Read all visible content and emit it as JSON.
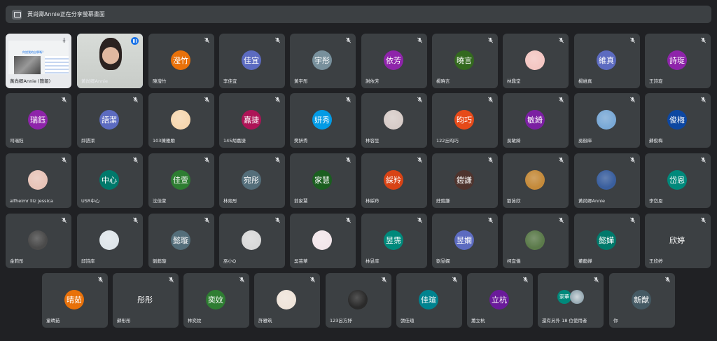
{
  "banner": {
    "text": "黃尚卿Annie正在分享螢幕畫面",
    "icon": "screen-share-icon"
  },
  "share_tile": {
    "slide_title": "你說我的自學嗎？",
    "name": "黃尚卿Annie (簡報)"
  },
  "self_tile": {
    "name": "黃尚卿Annie"
  },
  "tiles": [
    {
      "id": "t1",
      "name": "陳瀅竹",
      "initials": "瀅竹",
      "color": "#e8710a",
      "kind": "initials"
    },
    {
      "id": "t2",
      "name": "李佳宜",
      "initials": "佳宜",
      "color": "#5c6bc0",
      "kind": "initials"
    },
    {
      "id": "t3",
      "name": "黃宇彤",
      "initials": "宇彤",
      "color": "#78909c",
      "kind": "initials"
    },
    {
      "id": "t4",
      "name": "謝依芳",
      "initials": "依芳",
      "color": "#8e24aa",
      "kind": "initials"
    },
    {
      "id": "t5",
      "name": "楊曉言",
      "initials": "曉言",
      "color": "#33691e",
      "kind": "initials"
    },
    {
      "id": "t6",
      "name": "林鼎堂",
      "color": "#f4c7c3",
      "kind": "photo"
    },
    {
      "id": "t7",
      "name": "楊維真",
      "initials": "維真",
      "color": "#5c6bc0",
      "kind": "initials"
    },
    {
      "id": "t8",
      "name": "王詩琁",
      "initials": "詩琁",
      "color": "#8e24aa",
      "kind": "initials"
    },
    {
      "id": "t9",
      "name": "司瑞鈺",
      "initials": "瑞鈺",
      "color": "#8e24aa",
      "kind": "initials"
    },
    {
      "id": "t10",
      "name": "邱語潔",
      "initials": "語潔",
      "color": "#5c6bc0",
      "kind": "initials"
    },
    {
      "id": "t11",
      "name": "103陳雅勛",
      "color": "#f6d7b0",
      "kind": "photo"
    },
    {
      "id": "t12",
      "name": "145胡嘉捷",
      "initials": "嘉捷",
      "color": "#ad1457",
      "kind": "initials"
    },
    {
      "id": "t13",
      "name": "樊妍秀",
      "initials": "妍秀",
      "color": "#039be5",
      "kind": "initials"
    },
    {
      "id": "t14",
      "name": "林容呈",
      "color": "#d7ccc8",
      "kind": "photo"
    },
    {
      "id": "t15",
      "name": "122丘昀巧",
      "initials": "昀巧",
      "color": "#e64a19",
      "kind": "initials"
    },
    {
      "id": "t16",
      "name": "吳敏綺",
      "initials": "敏綺",
      "color": "#7b1fa2",
      "kind": "initials"
    },
    {
      "id": "t17",
      "name": "吳御庠",
      "color": "#7aa9d6",
      "kind": "photo"
    },
    {
      "id": "t18",
      "name": "蘇俊梅",
      "initials": "俊梅",
      "color": "#0d47a1",
      "kind": "initials"
    },
    {
      "id": "t19",
      "name": "alfheimr liiz jessica",
      "color": "#e8c4b8",
      "kind": "photo"
    },
    {
      "id": "t20",
      "name": "USR中心",
      "initials": "中心",
      "color": "#00796b",
      "kind": "initials"
    },
    {
      "id": "t21",
      "name": "沈佳萱",
      "initials": "佳萱",
      "color": "#2e7d32",
      "kind": "initials"
    },
    {
      "id": "t22",
      "name": "林宛彤",
      "initials": "宛彤",
      "color": "#546e7a",
      "kind": "initials"
    },
    {
      "id": "t23",
      "name": "翁家慧",
      "initials": "家慧",
      "color": "#1b5e20",
      "kind": "initials"
    },
    {
      "id": "t24",
      "name": "林綵羚",
      "initials": "綵羚",
      "color": "#d84315",
      "kind": "initials"
    },
    {
      "id": "t25",
      "name": "莊鎧謙",
      "initials": "鎧謙",
      "color": "#4e342e",
      "kind": "initials"
    },
    {
      "id": "t26",
      "name": "劉詠欣",
      "color": "#c48a3a",
      "kind": "photo"
    },
    {
      "id": "t27",
      "name": "黃尚卿Annie",
      "color": "#3a5f9e",
      "kind": "photo"
    },
    {
      "id": "t28",
      "name": "李岱恩",
      "initials": "岱恩",
      "color": "#00897b",
      "kind": "initials"
    },
    {
      "id": "t29",
      "name": "金莉彤",
      "color": "#4a4a4a",
      "kind": "photo"
    },
    {
      "id": "t30",
      "name": "邱詩庠",
      "color": "#dfe6ea",
      "kind": "photo"
    },
    {
      "id": "t31",
      "name": "劉懿璇",
      "initials": "懿璇",
      "color": "#546e7a",
      "kind": "initials"
    },
    {
      "id": "t32",
      "name": "巫小Q",
      "color": "#d9d9d9",
      "kind": "photo"
    },
    {
      "id": "t33",
      "name": "吳芸華",
      "color": "#f2e6ea",
      "kind": "photo"
    },
    {
      "id": "t34",
      "name": "林昱庠",
      "initials": "昱霈",
      "color": "#00897b",
      "kind": "initials"
    },
    {
      "id": "t35",
      "name": "劉昱嫻",
      "initials": "昱嫻",
      "color": "#5c6bc0",
      "kind": "initials"
    },
    {
      "id": "t36",
      "name": "柯宜儀",
      "color": "#5b7a4a",
      "kind": "photo"
    },
    {
      "id": "t37",
      "name": "董懿嬅",
      "initials": "懿嬅",
      "color": "#00796b",
      "kind": "initials"
    },
    {
      "id": "t38",
      "name": "王欣婷",
      "initials": "欣婷",
      "color": "#3c4043",
      "kind": "initials"
    },
    {
      "id": "t39",
      "name": "童晴茹",
      "initials": "晴茹",
      "color": "#e8710a",
      "kind": "initials"
    },
    {
      "id": "t40",
      "name": "蘇彤彤",
      "initials": "彤彤",
      "color": "#3c4043",
      "kind": "initials"
    },
    {
      "id": "t41",
      "name": "林奕妏",
      "initials": "奕妏",
      "color": "#2e7d32",
      "kind": "initials"
    },
    {
      "id": "t42",
      "name": "許雅筑",
      "color": "#efe4da",
      "kind": "photo"
    },
    {
      "id": "t43",
      "name": "123呂方妤",
      "color": "#2a2a2a",
      "kind": "photo"
    },
    {
      "id": "t44",
      "name": "張佳瑄",
      "initials": "佳瑄",
      "color": "#00838f",
      "kind": "initials"
    },
    {
      "id": "t45",
      "name": "蕭立杭",
      "initials": "立杭",
      "color": "#6a1b9a",
      "kind": "initials"
    },
    {
      "id": "t46",
      "name": "還有另外 18 位使用者",
      "initials": "家華",
      "color": "#00897b",
      "kind": "dual"
    },
    {
      "id": "t47",
      "name": "你",
      "initials": "新猷",
      "color": "#455a64",
      "kind": "initials"
    }
  ]
}
